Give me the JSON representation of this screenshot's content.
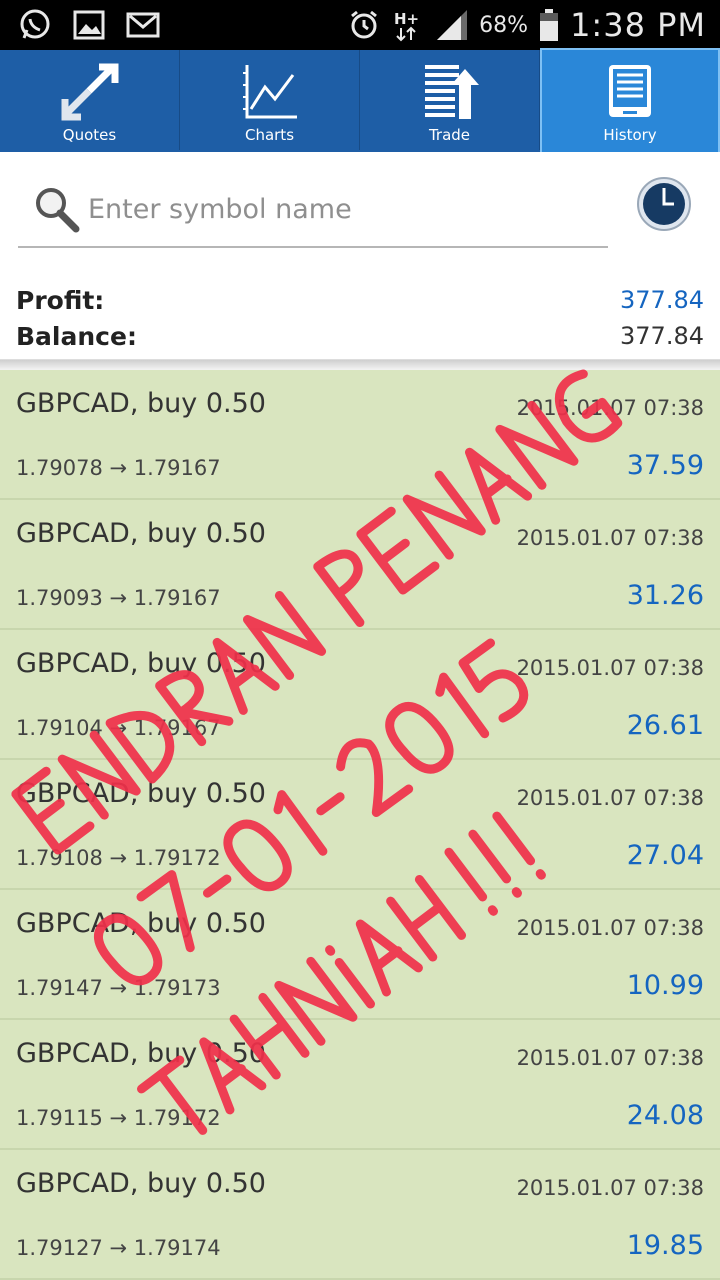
{
  "status_bar": {
    "battery_pct": "68%",
    "time": "1:38 PM",
    "left_icons": [
      "whatsapp-icon",
      "gallery-icon",
      "gmail-icon"
    ],
    "right_icons": [
      "alarm-icon",
      "hspa-plus-icon",
      "signal-icon",
      "battery-icon"
    ]
  },
  "tabs": [
    {
      "label": "Quotes",
      "icon": "quotes-arrows-icon",
      "active": false
    },
    {
      "label": "Charts",
      "icon": "charts-line-icon",
      "active": false
    },
    {
      "label": "Trade",
      "icon": "trade-list-icon",
      "active": false
    },
    {
      "label": "History",
      "icon": "history-document-icon",
      "active": true
    }
  ],
  "search": {
    "placeholder": "Enter symbol name",
    "period_icon": "clock-icon"
  },
  "summary": {
    "profit_label": "Profit:",
    "profit_value": "377.84",
    "balance_label": "Balance:",
    "balance_value": "377.84"
  },
  "deals": [
    {
      "symbol": "GBPCAD, buy 0.50",
      "time": "2015.01.07 07:38",
      "prices": "1.79078 → 1.79167",
      "profit": "37.59"
    },
    {
      "symbol": "GBPCAD, buy 0.50",
      "time": "2015.01.07 07:38",
      "prices": "1.79093 → 1.79167",
      "profit": "31.26"
    },
    {
      "symbol": "GBPCAD, buy 0.50",
      "time": "2015.01.07 07:38",
      "prices": "1.79104 → 1.79167",
      "profit": "26.61"
    },
    {
      "symbol": "GBPCAD, buy 0.50",
      "time": "2015.01.07 07:38",
      "prices": "1.79108 → 1.79172",
      "profit": "27.04"
    },
    {
      "symbol": "GBPCAD, buy 0.50",
      "time": "2015.01.07 07:38",
      "prices": "1.79147 → 1.79173",
      "profit": "10.99"
    },
    {
      "symbol": "GBPCAD, buy 0.50",
      "time": "2015.01.07 07:38",
      "prices": "1.79115 → 1.79172",
      "profit": "24.08"
    },
    {
      "symbol": "GBPCAD, buy 0.50",
      "time": "2015.01.07 07:38",
      "prices": "1.79127 → 1.79174",
      "profit": "19.85"
    }
  ],
  "handwritten_overlay": {
    "lines": [
      "ENDRAN PENANG",
      "07-01-2015",
      "TAHNIAH !!!"
    ],
    "color": "#f0304a"
  },
  "colors": {
    "tab_bar": "#1e5ea6",
    "tab_active": "#2a87d8",
    "deal_background": "#d9e5bf",
    "profit_blue": "#1565c0"
  }
}
